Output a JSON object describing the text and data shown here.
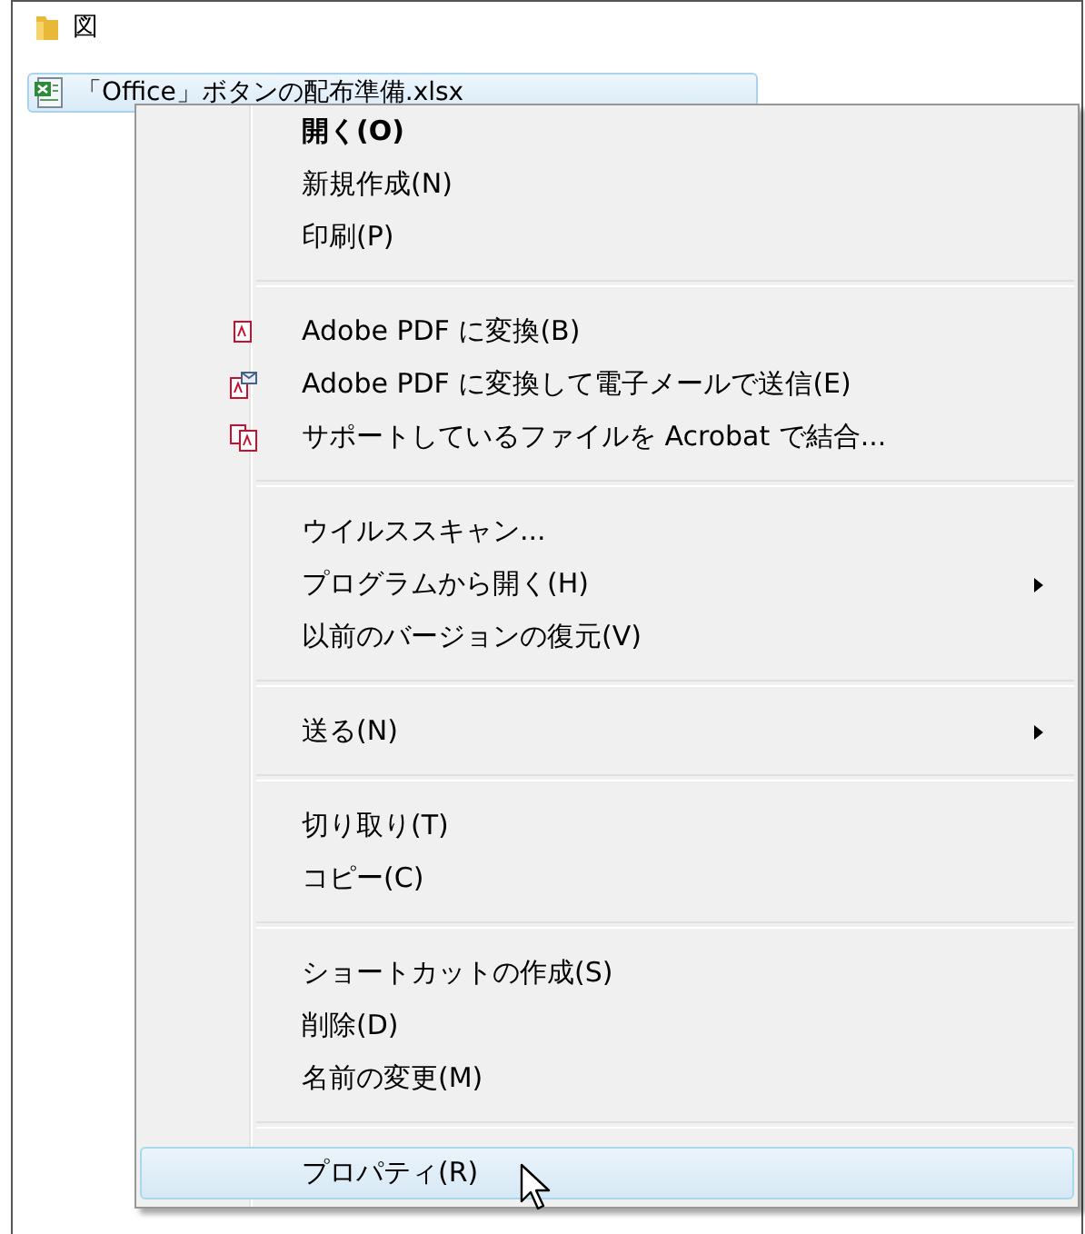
{
  "files": [
    {
      "name": "図",
      "kind": "folder",
      "selected": false
    },
    {
      "name": "「Office」ボタンの配布準備.xlsx",
      "kind": "spreadsheet",
      "selected": true
    }
  ],
  "context_menu": {
    "groups": [
      {
        "items": [
          {
            "label": "開く(O)",
            "kind": "plain",
            "bold": true,
            "submenu": false,
            "selected": false
          },
          {
            "label": "新規作成(N)",
            "kind": "plain",
            "bold": false,
            "submenu": false,
            "selected": false
          },
          {
            "label": "印刷(P)",
            "kind": "plain",
            "bold": false,
            "submenu": false,
            "selected": false
          }
        ]
      },
      {
        "items": [
          {
            "label": "Adobe PDF に変換(B)",
            "kind": "convert",
            "bold": false,
            "submenu": false,
            "selected": false
          },
          {
            "label": "Adobe PDF に変換して電子メールで送信(E)",
            "kind": "email",
            "bold": false,
            "submenu": false,
            "selected": false
          },
          {
            "label": "サポートしているファイルを Acrobat で結合...",
            "kind": "combine",
            "bold": false,
            "submenu": false,
            "selected": false
          }
        ]
      },
      {
        "items": [
          {
            "label": "ウイルススキャン...",
            "kind": "plain",
            "bold": false,
            "submenu": false,
            "selected": false
          },
          {
            "label": "プログラムから開く(H)",
            "kind": "plain",
            "bold": false,
            "submenu": true,
            "selected": false
          },
          {
            "label": "以前のバージョンの復元(V)",
            "kind": "plain",
            "bold": false,
            "submenu": false,
            "selected": false
          }
        ]
      },
      {
        "items": [
          {
            "label": "送る(N)",
            "kind": "plain",
            "bold": false,
            "submenu": true,
            "selected": false
          }
        ]
      },
      {
        "items": [
          {
            "label": "切り取り(T)",
            "kind": "plain",
            "bold": false,
            "submenu": false,
            "selected": false
          },
          {
            "label": "コピー(C)",
            "kind": "plain",
            "bold": false,
            "submenu": false,
            "selected": false
          }
        ]
      },
      {
        "items": [
          {
            "label": "ショートカットの作成(S)",
            "kind": "plain",
            "bold": false,
            "submenu": false,
            "selected": false
          },
          {
            "label": "削除(D)",
            "kind": "plain",
            "bold": false,
            "submenu": false,
            "selected": false
          },
          {
            "label": "名前の変更(M)",
            "kind": "plain",
            "bold": false,
            "submenu": false,
            "selected": false
          }
        ]
      },
      {
        "items": [
          {
            "label": "プロパティ(R)",
            "kind": "plain",
            "bold": false,
            "submenu": false,
            "selected": true
          }
        ]
      }
    ]
  }
}
